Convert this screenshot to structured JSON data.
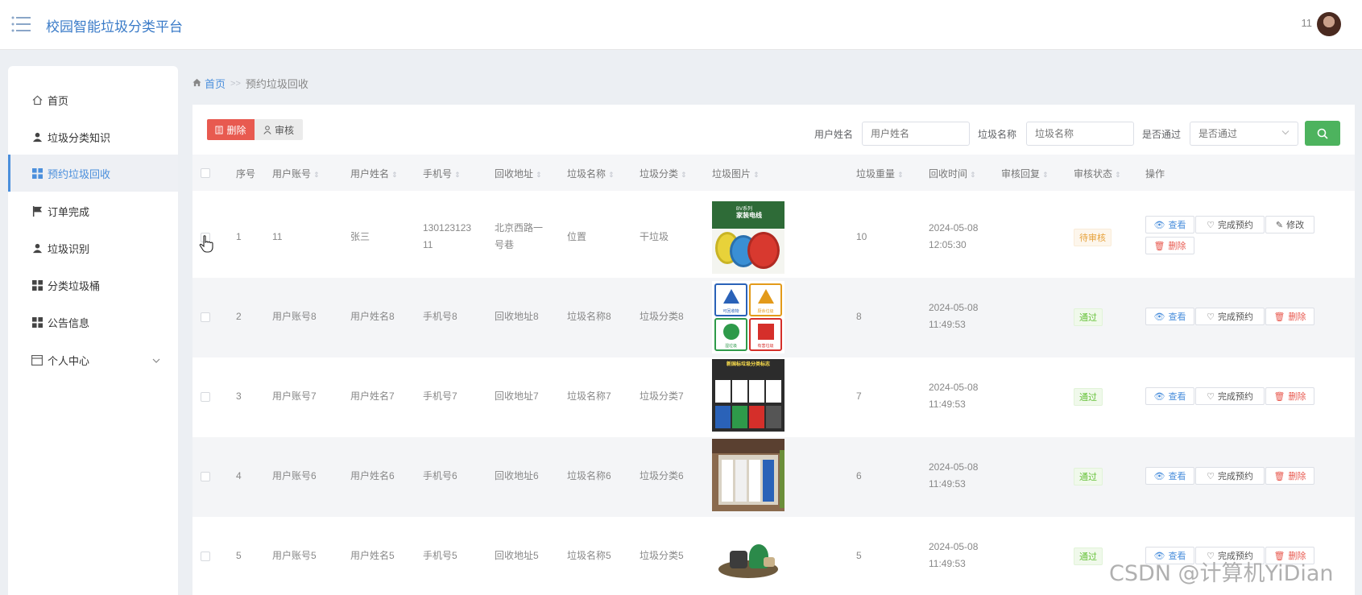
{
  "header": {
    "title": "校园智能垃圾分类平台",
    "username": "11"
  },
  "sidebar": {
    "items": [
      {
        "label": "首页",
        "icon": "home-icon"
      },
      {
        "label": "垃圾分类知识",
        "icon": "user-icon"
      },
      {
        "label": "预约垃圾回收",
        "icon": "grid-icon",
        "active": true
      },
      {
        "label": "订单完成",
        "icon": "flag-icon"
      },
      {
        "label": "垃圾识别",
        "icon": "user-icon"
      },
      {
        "label": "分类垃圾桶",
        "icon": "grid-icon"
      },
      {
        "label": "公告信息",
        "icon": "grid-icon"
      },
      {
        "label": "个人中心",
        "icon": "card-icon"
      }
    ]
  },
  "breadcrumb": {
    "home": "首页",
    "sep": ">>",
    "current": "预约垃圾回收"
  },
  "toolbar": {
    "delete_label": "删除",
    "audit_label": "审核"
  },
  "filters": {
    "username_label": "用户姓名",
    "username_placeholder": "用户姓名",
    "garbage_label": "垃圾名称",
    "garbage_placeholder": "垃圾名称",
    "passed_label": "是否通过",
    "passed_placeholder": "是否通过"
  },
  "table": {
    "headers": [
      "序号",
      "用户账号",
      "用户姓名",
      "手机号",
      "回收地址",
      "垃圾名称",
      "垃圾分类",
      "垃圾图片",
      "垃圾重量",
      "回收时间",
      "审核回复",
      "审核状态",
      "操作"
    ],
    "rows": [
      {
        "no": "1",
        "account": "11",
        "name": "张三",
        "phone1": "130123123",
        "phone2": "11",
        "addr1": "北京西路一",
        "addr2": "号巷",
        "gname": "位置",
        "gtype": "干垃圾",
        "weight": "10",
        "date": "2024-05-08",
        "time": "12:05:30",
        "status": "待审核"
      },
      {
        "no": "2",
        "account": "用户账号8",
        "name": "用户姓名8",
        "phone1": "手机号8",
        "phone2": "",
        "addr1": "回收地址8",
        "addr2": "",
        "gname": "垃圾名称8",
        "gtype": "垃圾分类8",
        "weight": "8",
        "date": "2024-05-08",
        "time": "11:49:53",
        "status": "通过"
      },
      {
        "no": "3",
        "account": "用户账号7",
        "name": "用户姓名7",
        "phone1": "手机号7",
        "phone2": "",
        "addr1": "回收地址7",
        "addr2": "",
        "gname": "垃圾名称7",
        "gtype": "垃圾分类7",
        "weight": "7",
        "date": "2024-05-08",
        "time": "11:49:53",
        "status": "通过"
      },
      {
        "no": "4",
        "account": "用户账号6",
        "name": "用户姓名6",
        "phone1": "手机号6",
        "phone2": "",
        "addr1": "回收地址6",
        "addr2": "",
        "gname": "垃圾名称6",
        "gtype": "垃圾分类6",
        "weight": "6",
        "date": "2024-05-08",
        "time": "11:49:53",
        "status": "通过"
      },
      {
        "no": "5",
        "account": "用户账号5",
        "name": "用户姓名5",
        "phone1": "手机号5",
        "phone2": "",
        "addr1": "回收地址5",
        "addr2": "",
        "gname": "垃圾名称5",
        "gtype": "垃圾分类5",
        "weight": "5",
        "date": "2024-05-08",
        "time": "11:49:53",
        "status": "通过"
      }
    ],
    "actions": {
      "view": "查看",
      "complete": "完成预约",
      "edit": "修改",
      "delete": "删除"
    }
  },
  "thumbs": {
    "row1": {
      "line1": "BV系列",
      "line2": "家装电线"
    },
    "row2": {
      "c1": "可回收物",
      "c2": "厨余垃圾",
      "c3": "湿垃圾",
      "c4": "有害垃圾"
    },
    "row3": {
      "title": "新国标垃圾分类标志"
    }
  },
  "watermark": "CSDN @计算机YiDian",
  "colors": {
    "primary": "#4b8fdc",
    "danger": "#e85a50",
    "success": "#4db35e",
    "warning": "#e6a23c"
  }
}
